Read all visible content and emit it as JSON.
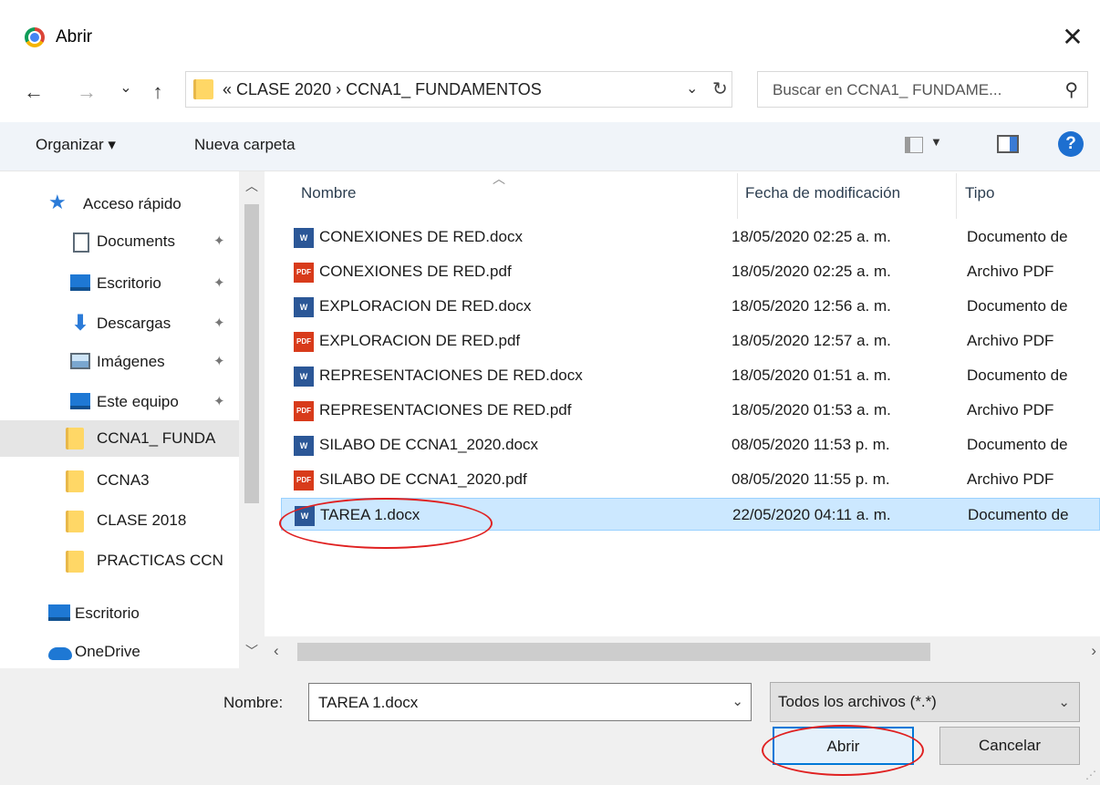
{
  "window": {
    "title": "Abrir",
    "close_glyph": "✕",
    "app_icon": "chrome-icon"
  },
  "nav": {
    "back": "←",
    "forward": "→",
    "recent": "⌄",
    "up": "↑"
  },
  "address": {
    "prefix": "«",
    "crumbs": [
      "CLASE 2020",
      "CCNA1_ FUNDAMENTOS"
    ],
    "separator": "›",
    "text": "«  CLASE 2020  ›  CCNA1_ FUNDAMENTOS"
  },
  "search": {
    "placeholder": "Buscar en CCNA1_ FUNDAME..."
  },
  "toolbar": {
    "organize": "Organizar ▾",
    "new_folder": "Nueva carpeta"
  },
  "sidebar": {
    "items": [
      {
        "label": "Acceso rápido",
        "icon": "star-icon"
      },
      {
        "label": "Documents",
        "icon": "document-icon",
        "pinned": true
      },
      {
        "label": "Escritorio",
        "icon": "desktop-icon",
        "pinned": true
      },
      {
        "label": "Descargas",
        "icon": "download-icon",
        "pinned": true
      },
      {
        "label": "Imágenes",
        "icon": "pictures-icon",
        "pinned": true
      },
      {
        "label": "Este equipo",
        "icon": "computer-icon",
        "pinned": true
      },
      {
        "label": "CCNA1_ FUNDA",
        "icon": "folder-icon",
        "selected": true
      },
      {
        "label": "CCNA3",
        "icon": "folder-icon"
      },
      {
        "label": "CLASE 2018",
        "icon": "folder-icon"
      },
      {
        "label": "PRACTICAS CCN",
        "icon": "folder-icon"
      },
      {
        "label": "Escritorio",
        "icon": "desktop-icon"
      },
      {
        "label": "OneDrive",
        "icon": "cloud-icon"
      }
    ]
  },
  "columns": {
    "name": "Nombre",
    "date": "Fecha de modificación",
    "type": "Tipo"
  },
  "files": [
    {
      "name": "CONEXIONES DE RED.docx",
      "date": "18/05/2020 02:25 a. m.",
      "type": "Documento de",
      "kind": "word"
    },
    {
      "name": "CONEXIONES DE RED.pdf",
      "date": "18/05/2020 02:25 a. m.",
      "type": "Archivo PDF",
      "kind": "pdf"
    },
    {
      "name": "EXPLORACION DE RED.docx",
      "date": "18/05/2020 12:56 a. m.",
      "type": "Documento de",
      "kind": "word"
    },
    {
      "name": "EXPLORACION DE RED.pdf",
      "date": "18/05/2020 12:57 a. m.",
      "type": "Archivo PDF",
      "kind": "pdf"
    },
    {
      "name": "REPRESENTACIONES DE RED.docx",
      "date": "18/05/2020 01:51 a. m.",
      "type": "Documento de",
      "kind": "word"
    },
    {
      "name": "REPRESENTACIONES DE RED.pdf",
      "date": "18/05/2020 01:53 a. m.",
      "type": "Archivo PDF",
      "kind": "pdf"
    },
    {
      "name": "SILABO DE CCNA1_2020.docx",
      "date": "08/05/2020 11:53 p. m.",
      "type": "Documento de",
      "kind": "word"
    },
    {
      "name": "SILABO DE CCNA1_2020.pdf",
      "date": "08/05/2020 11:55 p. m.",
      "type": "Archivo PDF",
      "kind": "pdf"
    },
    {
      "name": "TAREA 1.docx",
      "date": "22/05/2020 04:11 a. m.",
      "type": "Documento de",
      "kind": "word",
      "selected": true
    }
  ],
  "file_icon_text": {
    "word": "W",
    "pdf": "PDF"
  },
  "footer": {
    "name_label": "Nombre:",
    "name_value": "TAREA 1.docx",
    "filter": "Todos los archivos (*.*)",
    "open": "Abrir",
    "cancel": "Cancelar"
  },
  "colors": {
    "accent": "#0078d7",
    "selection": "#cce8ff",
    "annotation": "#e02020"
  }
}
